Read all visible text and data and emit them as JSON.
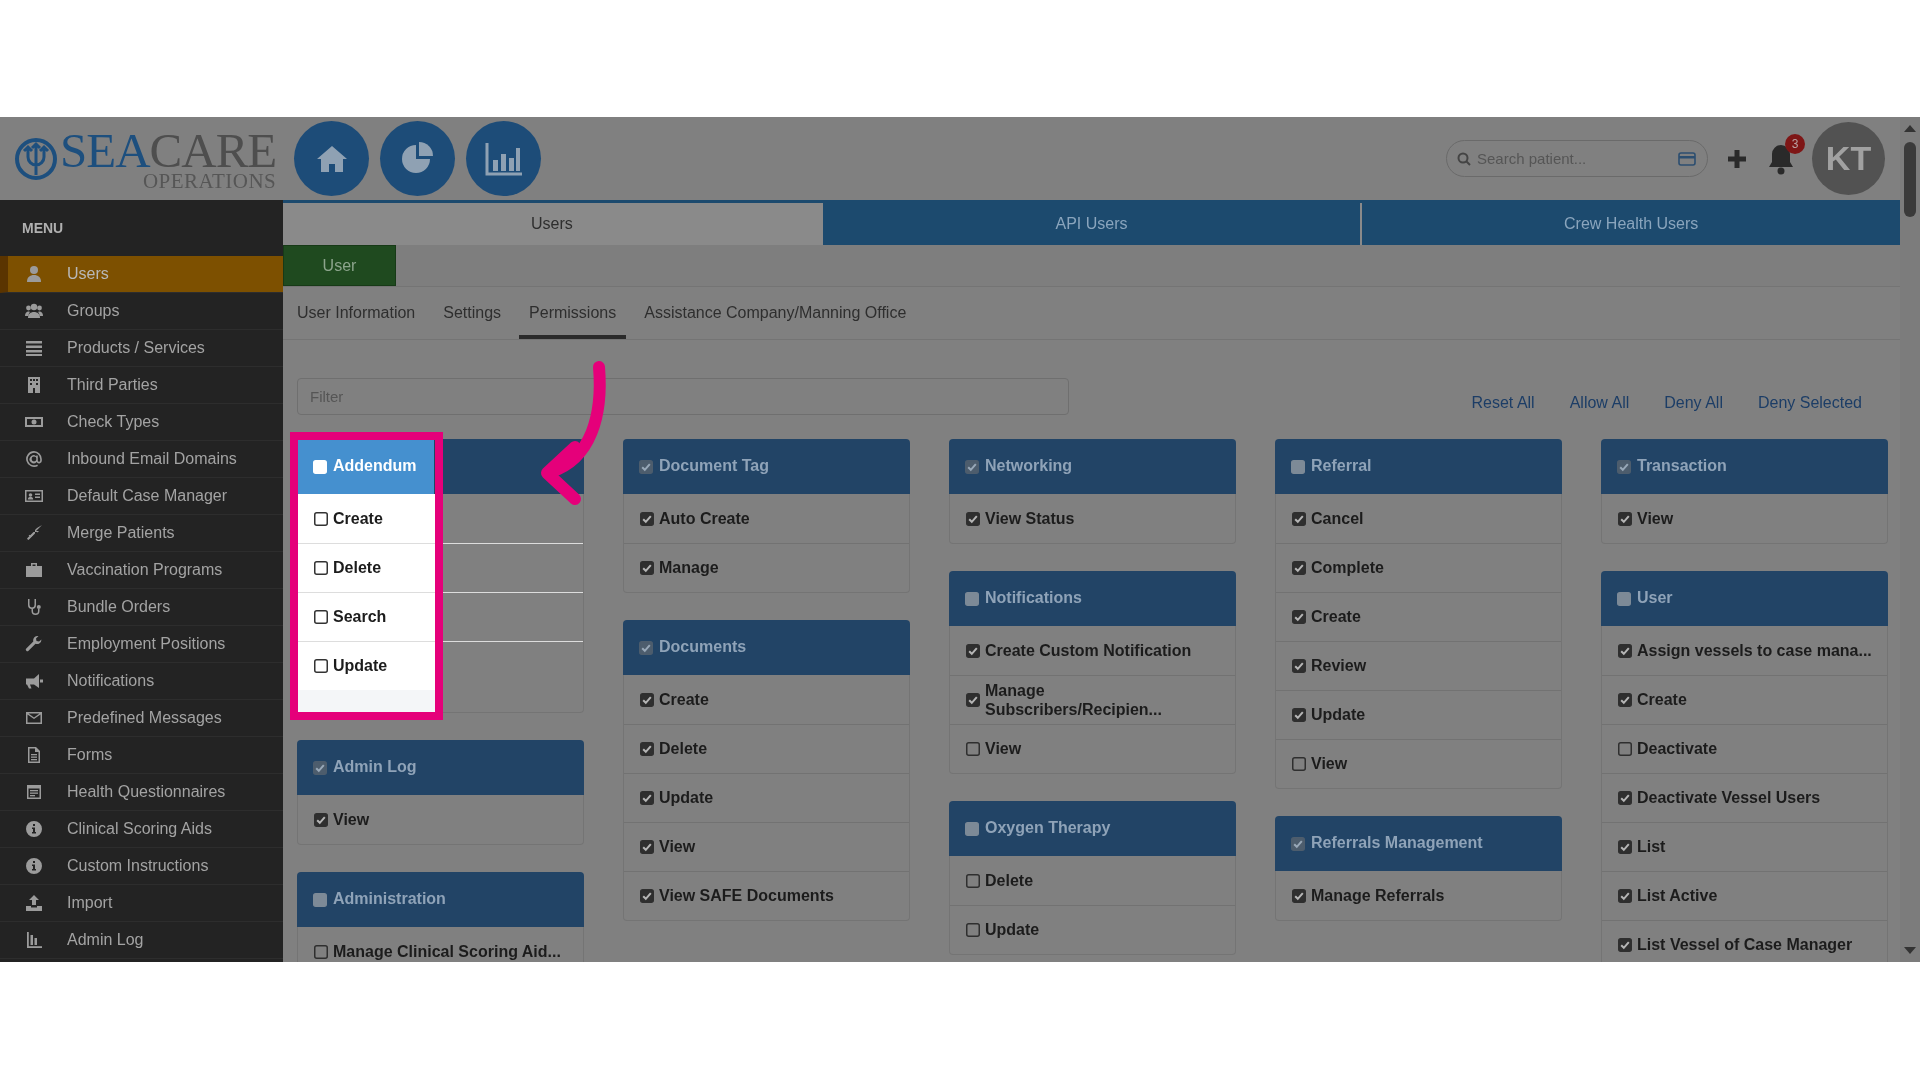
{
  "header": {
    "logo": {
      "part_1": "SEA",
      "part_2": "CARE",
      "tagline": "OPERATIONS"
    },
    "search": {
      "placeholder": "Search patient..."
    },
    "notification_count": "3",
    "avatar_initials": "KT"
  },
  "sidebar": {
    "title": "MENU",
    "items": [
      {
        "label": "Users",
        "selected": true
      },
      {
        "label": "Groups",
        "selected": false
      },
      {
        "label": "Products / Services",
        "selected": false
      },
      {
        "label": "Third Parties",
        "selected": false
      },
      {
        "label": "Check Types",
        "selected": false
      },
      {
        "label": "Inbound Email Domains",
        "selected": false
      },
      {
        "label": "Default Case Manager",
        "selected": false
      },
      {
        "label": "Merge Patients",
        "selected": false
      },
      {
        "label": "Vaccination Programs",
        "selected": false
      },
      {
        "label": "Bundle Orders",
        "selected": false
      },
      {
        "label": "Employment Positions",
        "selected": false
      },
      {
        "label": "Notifications",
        "selected": false
      },
      {
        "label": "Predefined Messages",
        "selected": false
      },
      {
        "label": "Forms",
        "selected": false
      },
      {
        "label": "Health Questionnaires",
        "selected": false
      },
      {
        "label": "Clinical Scoring Aids",
        "selected": false
      },
      {
        "label": "Custom Instructions",
        "selected": false
      },
      {
        "label": "Import",
        "selected": false
      },
      {
        "label": "Admin Log",
        "selected": false
      }
    ]
  },
  "tabs": [
    {
      "label": "Users",
      "selected": true
    },
    {
      "label": "API Users",
      "selected": false
    },
    {
      "label": "Crew Health Users",
      "selected": false
    }
  ],
  "user_button": "User",
  "subtabs": [
    {
      "label": "User Information",
      "selected": false
    },
    {
      "label": "Settings",
      "selected": false
    },
    {
      "label": "Permissions",
      "selected": true
    },
    {
      "label": "Assistance Company/Manning Office",
      "selected": false
    }
  ],
  "filter": {
    "placeholder": "Filter"
  },
  "actions": [
    "Reset All",
    "Allow All",
    "Deny All",
    "Deny Selected"
  ],
  "columns": [
    [
      {
        "title": "Addendum",
        "checked": false,
        "highlighted": true,
        "permissions": [
          {
            "label": "Create",
            "checked": false
          },
          {
            "label": "Delete",
            "checked": false
          },
          {
            "label": "Search",
            "checked": false
          },
          {
            "label": "Update",
            "checked": false
          }
        ]
      },
      {
        "title": "Admin Log",
        "checked": true,
        "highlighted": false,
        "permissions": [
          {
            "label": "View",
            "checked": true
          }
        ]
      },
      {
        "title": "Administration",
        "checked": false,
        "highlighted": false,
        "permissions": [
          {
            "label": "Manage Clinical Scoring Aid...",
            "checked": false
          }
        ]
      }
    ],
    [
      {
        "title": "Document Tag",
        "checked": true,
        "highlighted": false,
        "permissions": [
          {
            "label": "Auto Create",
            "checked": true
          },
          {
            "label": "Manage",
            "checked": true
          }
        ]
      },
      {
        "title": "Documents",
        "checked": true,
        "highlighted": false,
        "permissions": [
          {
            "label": "Create",
            "checked": true
          },
          {
            "label": "Delete",
            "checked": true
          },
          {
            "label": "Update",
            "checked": true
          },
          {
            "label": "View",
            "checked": true
          },
          {
            "label": "View SAFE Documents",
            "checked": true
          }
        ]
      }
    ],
    [
      {
        "title": "Networking",
        "checked": true,
        "highlighted": false,
        "permissions": [
          {
            "label": "View Status",
            "checked": true
          }
        ]
      },
      {
        "title": "Notifications",
        "checked": false,
        "highlighted": false,
        "permissions": [
          {
            "label": "Create Custom Notification",
            "checked": true
          },
          {
            "label": "Manage Subscribers/Recipien...",
            "checked": true
          },
          {
            "label": "View",
            "checked": false
          }
        ]
      },
      {
        "title": "Oxygen Therapy",
        "checked": false,
        "highlighted": false,
        "permissions": [
          {
            "label": "Delete",
            "checked": false
          },
          {
            "label": "Update",
            "checked": false
          }
        ]
      }
    ],
    [
      {
        "title": "Referral",
        "checked": false,
        "highlighted": false,
        "permissions": [
          {
            "label": "Cancel",
            "checked": true
          },
          {
            "label": "Complete",
            "checked": true
          },
          {
            "label": "Create",
            "checked": true
          },
          {
            "label": "Review",
            "checked": true
          },
          {
            "label": "Update",
            "checked": true
          },
          {
            "label": "View",
            "checked": false
          }
        ]
      },
      {
        "title": "Referrals Management",
        "checked": true,
        "highlighted": false,
        "permissions": [
          {
            "label": "Manage Referrals",
            "checked": true
          }
        ]
      }
    ],
    [
      {
        "title": "Transaction",
        "checked": true,
        "highlighted": false,
        "permissions": [
          {
            "label": "View",
            "checked": true
          }
        ]
      },
      {
        "title": "User",
        "checked": false,
        "highlighted": false,
        "permissions": [
          {
            "label": "Assign vessels to case mana...",
            "checked": true
          },
          {
            "label": "Create",
            "checked": true
          },
          {
            "label": "Deactivate",
            "checked": false
          },
          {
            "label": "Deactivate Vessel Users",
            "checked": true
          },
          {
            "label": "List",
            "checked": true
          },
          {
            "label": "List Active",
            "checked": true
          },
          {
            "label": "List Vessel of Case Manager",
            "checked": true
          }
        ]
      }
    ]
  ]
}
